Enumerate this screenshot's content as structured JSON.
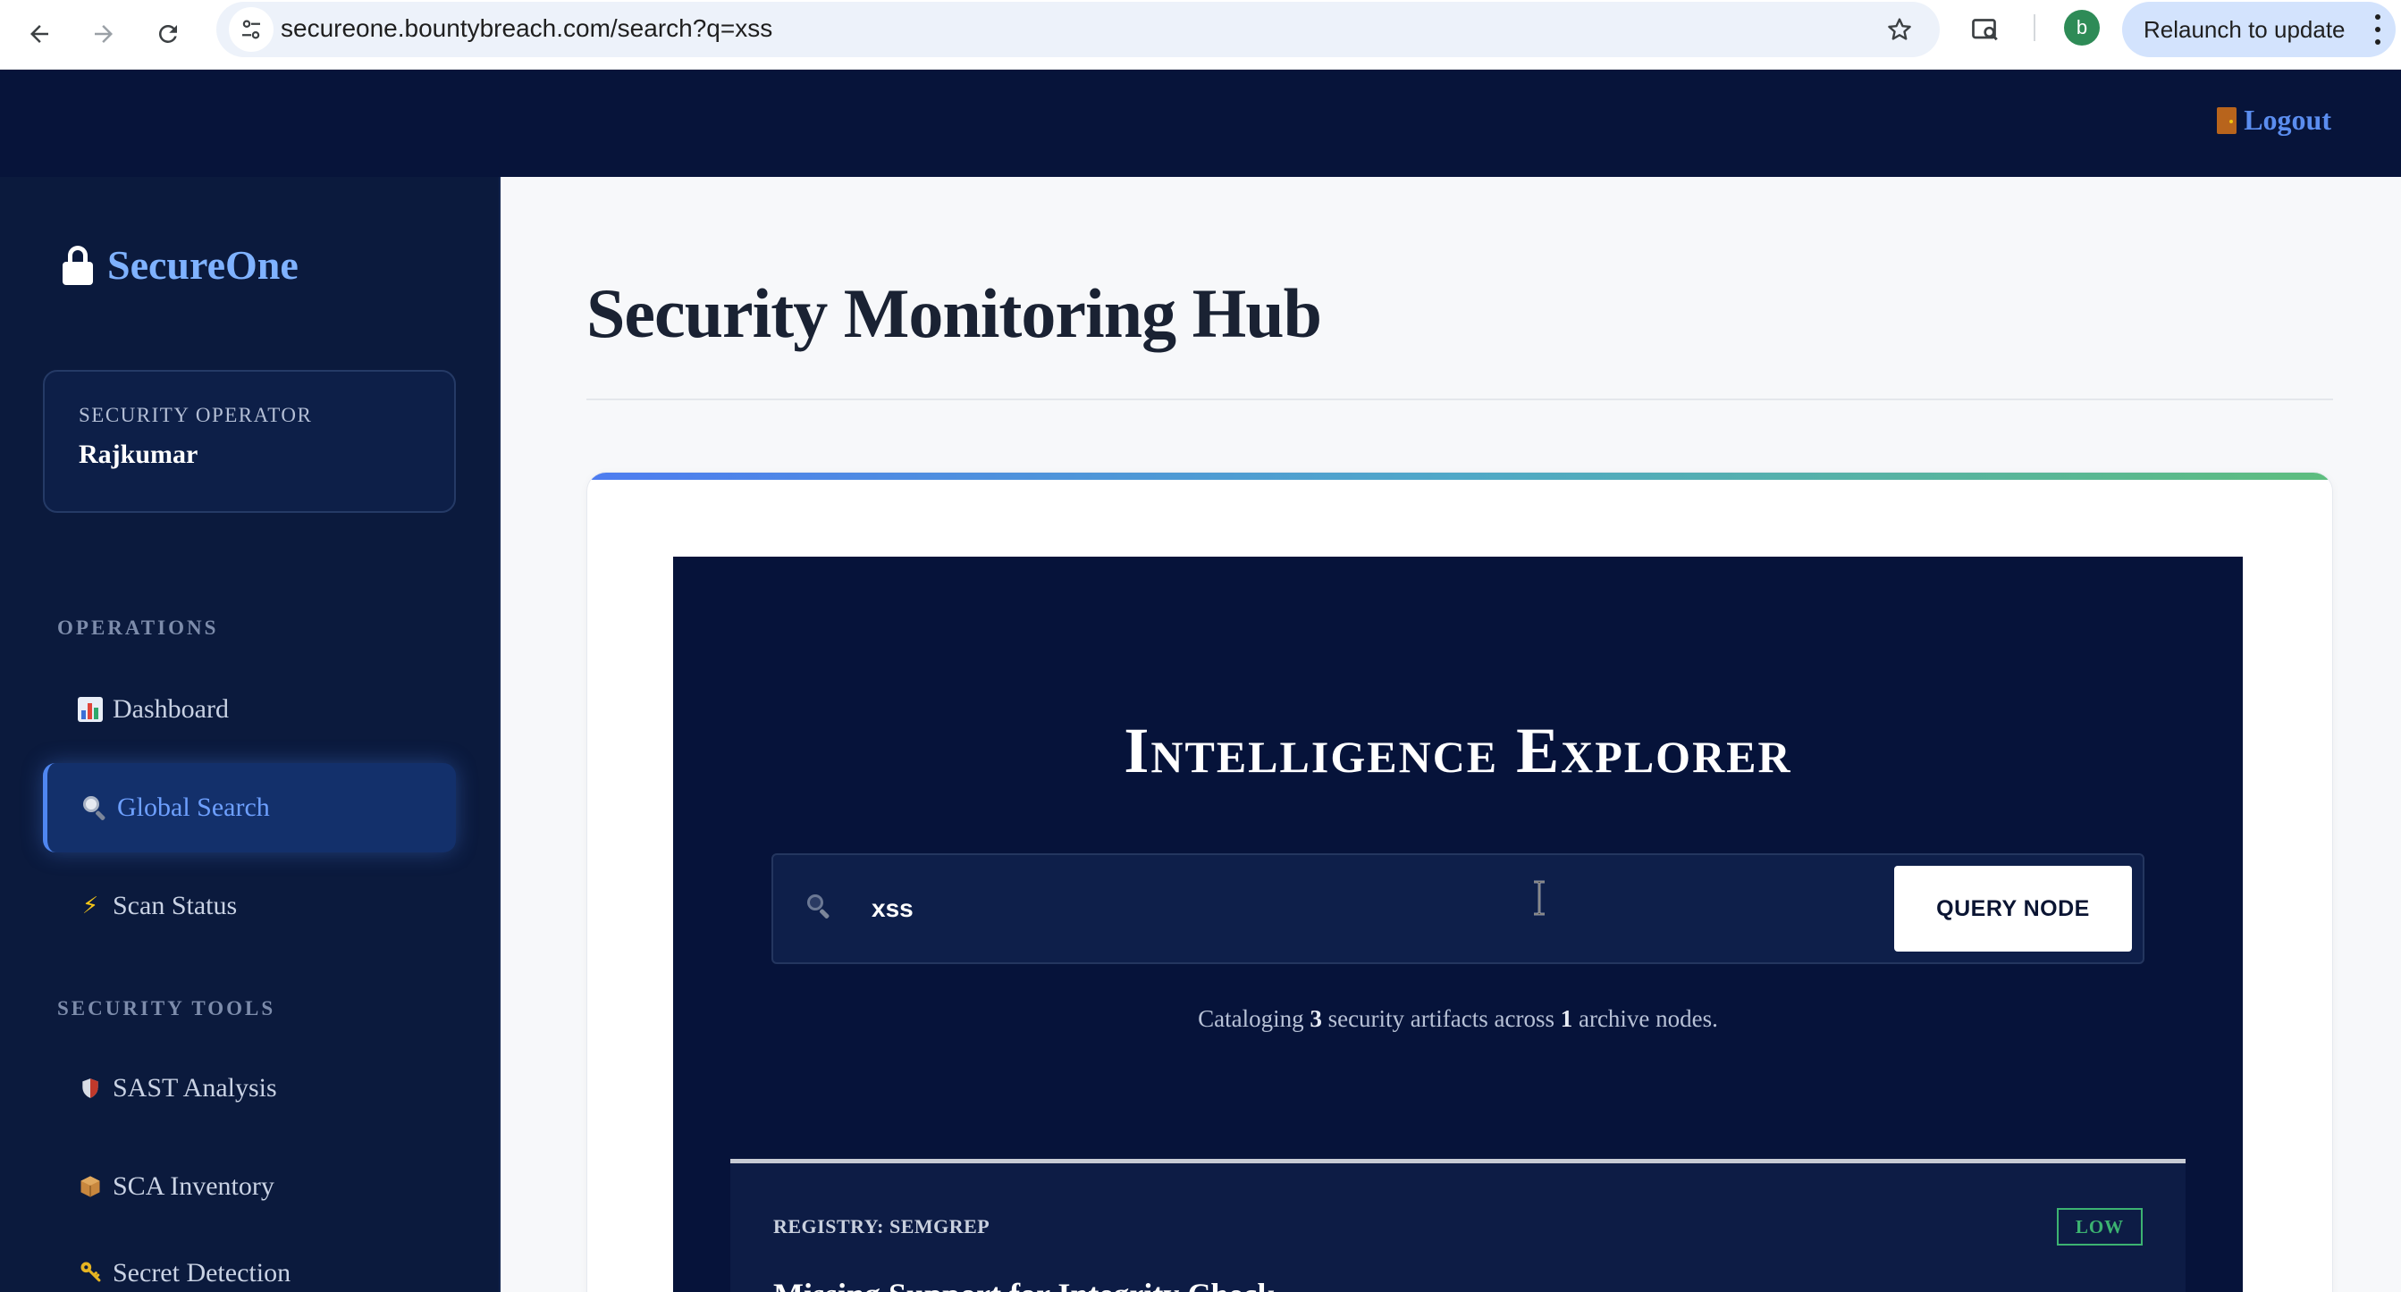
{
  "browser": {
    "url": "secureone.bountybreach.com/search?q=xss",
    "profile_initial": "b",
    "relaunch_label": "Relaunch to update"
  },
  "header": {
    "logout_label": "Logout"
  },
  "sidebar": {
    "brand": "SecureOne",
    "operator_role": "SECURITY OPERATOR",
    "operator_name": "Rajkumar",
    "sections": [
      {
        "title": "OPERATIONS",
        "items": [
          {
            "label": "Dashboard",
            "icon": "bar-chart-icon",
            "active": false
          },
          {
            "label": "Global Search",
            "icon": "magnifier-icon",
            "active": true
          },
          {
            "label": "Scan Status",
            "icon": "lightning-icon",
            "active": false
          }
        ]
      },
      {
        "title": "SECURITY TOOLS",
        "items": [
          {
            "label": "SAST Analysis",
            "icon": "shield-icon",
            "active": false
          },
          {
            "label": "SCA Inventory",
            "icon": "package-icon",
            "active": false
          },
          {
            "label": "Secret Detection",
            "icon": "key-icon",
            "active": false
          }
        ]
      }
    ]
  },
  "main": {
    "page_title": "Security Monitoring Hub",
    "explorer": {
      "title": "Intelligence Explorer",
      "search_value": "xss",
      "query_button": "QUERY NODE",
      "catalog_prefix": "Cataloging",
      "artifact_count": "3",
      "catalog_middle": "security artifacts across",
      "node_count": "1",
      "catalog_suffix": "archive nodes."
    },
    "results": [
      {
        "registry": "REGISTRY: SEMGREP",
        "severity": "LOW",
        "title": "Missing Support for Integrity Check"
      }
    ]
  },
  "colors": {
    "sidebar_bg": "#0b1a3d",
    "header_bg": "#07143a",
    "accent": "#4f86f0",
    "severity_low": "#3cb371"
  }
}
